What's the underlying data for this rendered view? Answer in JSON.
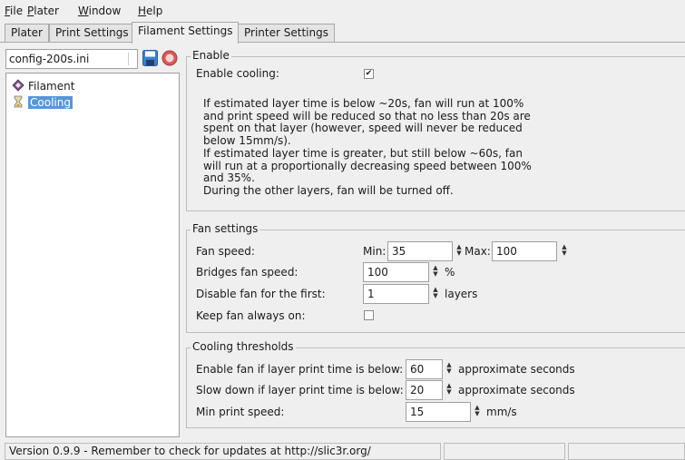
{
  "menubar": {
    "items": [
      {
        "mnemonic": "F",
        "rest": "ile"
      },
      {
        "mnemonic": "P",
        "rest": "later"
      },
      {
        "mnemonic": "W",
        "rest": "indow"
      },
      {
        "mnemonic": "H",
        "rest": "elp"
      }
    ]
  },
  "tabs": [
    {
      "label": "Plater",
      "active": false
    },
    {
      "label": "Print Settings",
      "active": false
    },
    {
      "label": "Filament Settings",
      "active": true
    },
    {
      "label": "Printer Settings",
      "active": false
    }
  ],
  "left_panel": {
    "preset": "config-200s.ini",
    "tree": [
      {
        "label": "Filament",
        "icon": "spool-icon",
        "selected": false
      },
      {
        "label": "Cooling",
        "icon": "hourglass-icon",
        "selected": true
      }
    ]
  },
  "enable_group": {
    "title": "Enable",
    "enable_cooling_label": "Enable cooling:",
    "enable_cooling_checked": true,
    "checkmark": "✔",
    "description": "If estimated layer time is below ~20s, fan will run at 100%\nand print speed will be reduced so that no less than 20s are\nspent on that layer (however, speed will never be reduced\nbelow 15mm/s).\nIf estimated layer time is greater, but still below ~60s, fan\nwill run at a proportionally decreasing speed between 100%\nand 35%.\nDuring the other layers, fan will be turned off."
  },
  "fan_group": {
    "title": "Fan settings",
    "fan_speed_label": "Fan speed:",
    "min_label": "Min:",
    "min_value": "35",
    "max_label": "Max:",
    "max_value": "100",
    "bridges_label": "Bridges fan speed:",
    "bridges_value": "100",
    "bridges_unit": "%",
    "disable_label": "Disable fan for the first:",
    "disable_value": "1",
    "disable_unit": "layers",
    "keep_on_label": "Keep fan always on:",
    "keep_on_checked": false
  },
  "cooling_group": {
    "title": "Cooling thresholds",
    "enable_below_label": "Enable fan if layer print time is below:",
    "enable_below_value": "60",
    "enable_below_unit": "approximate seconds",
    "slow_below_label": "Slow down if layer print time is below:",
    "slow_below_value": "20",
    "slow_below_unit": "approximate seconds",
    "min_speed_label": "Min print speed:",
    "min_speed_value": "15",
    "min_speed_unit": "mm/s"
  },
  "statusbar": {
    "text": "Version 0.9.9 - Remember to check for updates at http://slic3r.org/"
  },
  "colors": {
    "selection": "#5796d8",
    "window_bg": "#efefef"
  }
}
